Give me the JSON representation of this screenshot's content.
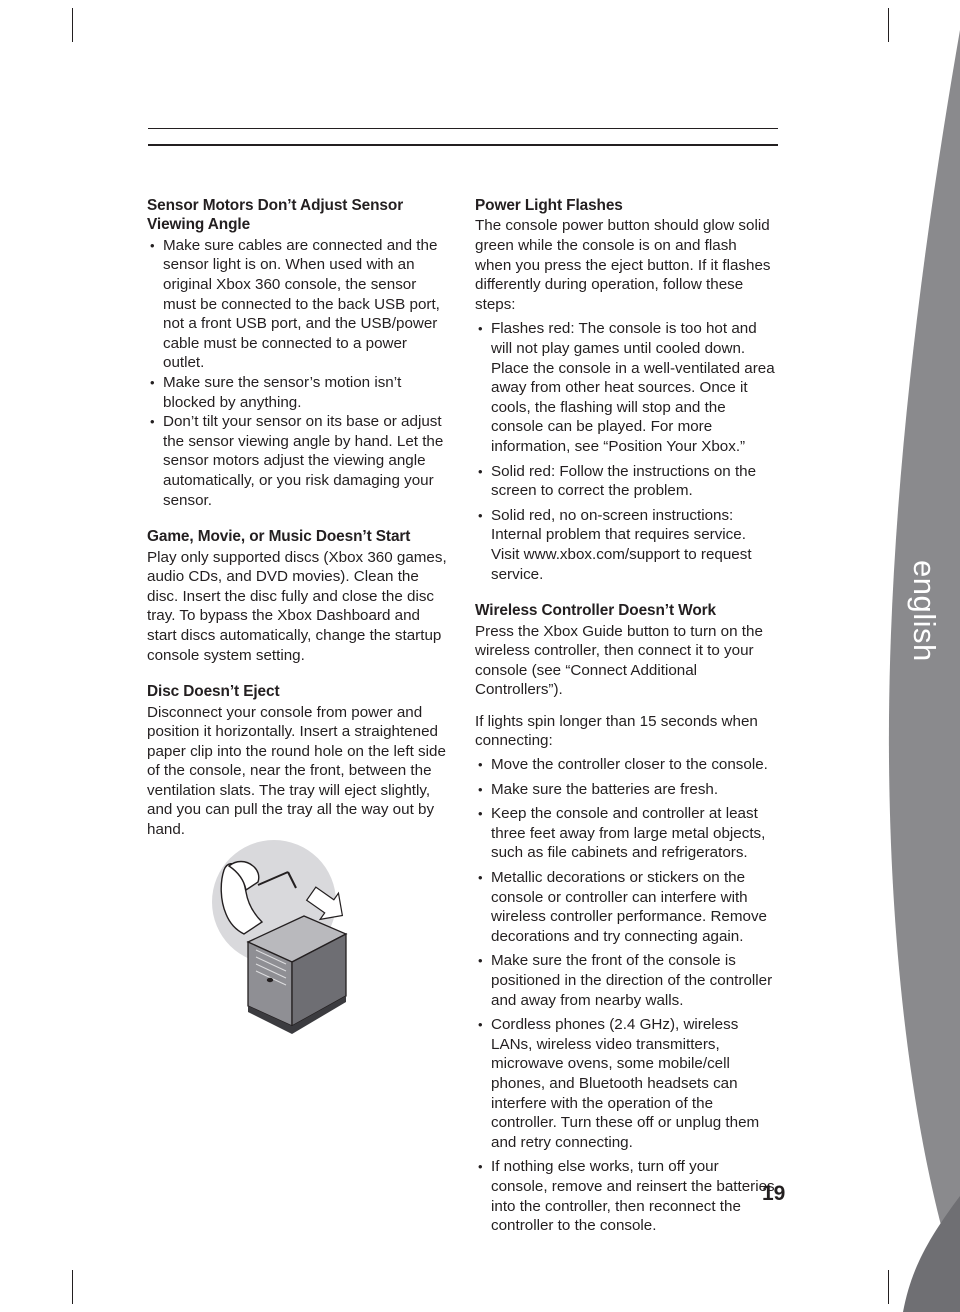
{
  "page": {
    "number": "19",
    "side_tab_label": "english",
    "accent_color": "#8a8a8d"
  },
  "left_column": {
    "sections": [
      {
        "heading": "Sensor Motors Don’t Adjust Sensor Viewing Angle",
        "bullets": [
          "Make sure cables are connected and the sensor light is on. When used with an original Xbox 360 console, the sensor must be connected to the back USB port, not a front USB port, and the USB/power cable must be connected to a power outlet.",
          "Make sure the sensor’s motion isn’t blocked by anything.",
          "Don’t tilt your sensor on its base or adjust the sensor viewing angle by hand. Let the sensor motors adjust the viewing angle automatically, or you risk damaging your sensor."
        ]
      },
      {
        "heading": "Game, Movie, or Music Doesn’t Start",
        "paragraph": "Play only supported discs (Xbox 360 games, audio CDs, and DVD movies). Clean the disc. Insert the disc fully and close the disc tray. To bypass the Xbox Dashboard and start discs automatically, change the startup console system setting."
      },
      {
        "heading": "Disc Doesn’t Eject",
        "paragraph": "Disconnect your console from power and position it horizontally. Insert a straightened paper clip into the round hole on the left side of the console, near the front, between the ventilation slats. The tray will eject slightly, and you can pull the tray all the way out by hand."
      }
    ],
    "illustration_name": "paper-clip-eject-illustration"
  },
  "right_column": {
    "sections": [
      {
        "heading": "Power Light Flashes",
        "paragraph": "The console power button should glow solid green while the console is on and flash when you press the eject button. If it flashes differently during operation, follow these steps:",
        "bullets": [
          "Flashes red: The console is too hot and will not play games until cooled down. Place the console in a well-ventilated area away from other heat sources. Once it cools, the flashing will stop and the console can be played. For more information, see “Position Your Xbox.”",
          "Solid red: Follow the instructions on the screen to correct the problem.",
          "Solid red, no on-screen instructions: Internal problem that requires service. Visit www.xbox.com/support to request service."
        ]
      },
      {
        "heading": "Wireless Controller Doesn’t Work",
        "paragraph": "Press the Xbox Guide button to turn on the wireless controller, then connect it to your console (see “Connect Additional Controllers”).",
        "paragraph2": "If lights spin longer than 15 seconds when connecting:",
        "bullets": [
          "Move the controller closer to the console.",
          "Make sure the batteries are fresh.",
          "Keep the console and controller at least three feet away from large metal objects, such as file cabinets and refrigerators.",
          "Metallic decorations or stickers on the console or controller can interfere with wireless controller performance. Remove decorations and try connecting again.",
          "Make sure the front of the console is positioned in the direction of the controller and away from nearby walls.",
          "Cordless phones (2.4 GHz), wireless LANs, wireless video transmitters, microwave ovens, some mobile/cell phones, and Bluetooth headsets can interfere with the operation of the controller. Turn these off or unplug them and retry connecting.",
          "If nothing else works, turn off your console, remove and reinsert the batteries into the controller, then reconnect the controller to the console."
        ]
      }
    ]
  }
}
